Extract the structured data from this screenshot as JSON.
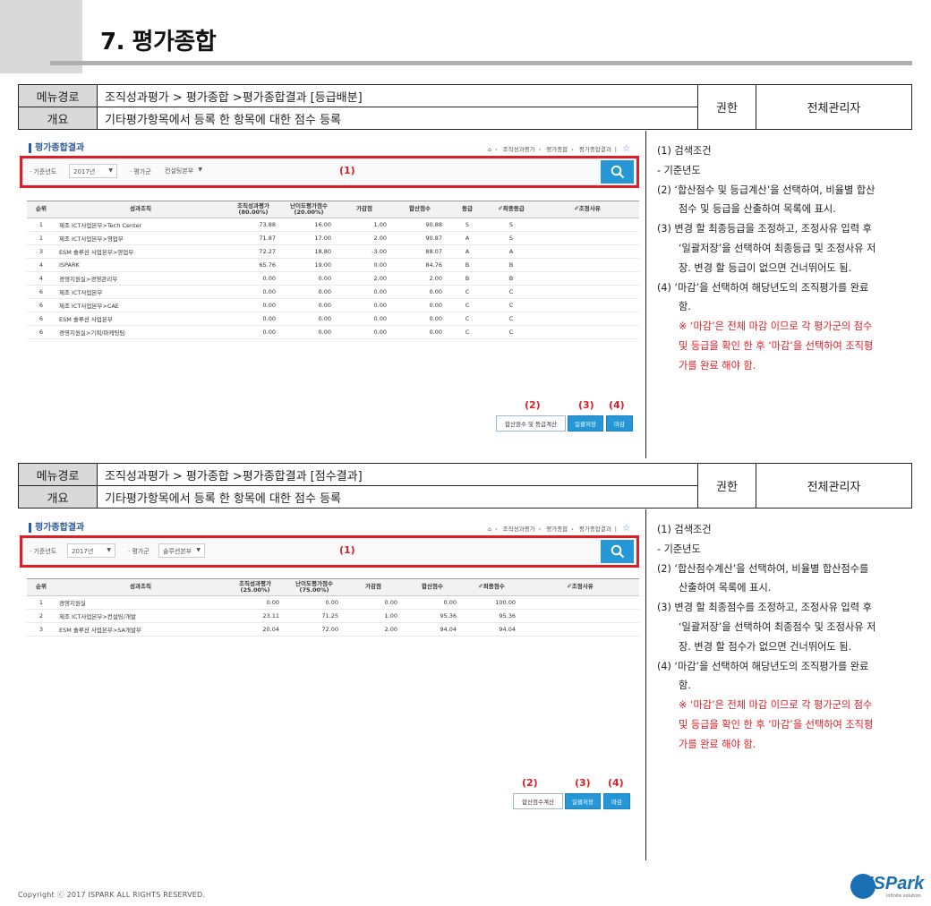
{
  "page_title": "7. 평가종합",
  "section1": {
    "menu_label": "메뉴경로",
    "menu_value": "조직성과평가 > 평가종합 >평가종합결과 [등급배분]",
    "summary_label": "개요",
    "summary_value": "기타평가항목에서 등록 한 항목에 대한 점수 등록",
    "perm_label": "권한",
    "perm_value": "전체관리자",
    "screen": {
      "title": "평가종합결과",
      "breadcrumb": [
        "조직성과평가",
        "평가종합",
        "평가종합결과"
      ],
      "year_label": "· 기준년도",
      "year_value": "2017년",
      "group_label": "· 평가군",
      "group_value": "컨설팅본부",
      "mark1": "(1)",
      "columns": [
        "순위",
        "성과조직",
        "조직성과평가 (80.00%)",
        "난이도평가점수 (20.00%)",
        "가감점",
        "합산점수",
        "등급",
        "✐최종등급",
        "✐조정사유"
      ],
      "rows": [
        [
          "1",
          "제조 ICT사업본부>Tech Center",
          "73.88",
          "16.00",
          "1.00",
          "90.88",
          "S",
          "S",
          ""
        ],
        [
          "1",
          "제조 ICT사업본부>영업부",
          "71.87",
          "17.00",
          "2.00",
          "90.87",
          "A",
          "S",
          ""
        ],
        [
          "3",
          "ESM 솔루션 사업본부>영업부",
          "72.27",
          "18.80",
          "-3.00",
          "88.07",
          "A",
          "A",
          ""
        ],
        [
          "4",
          "ISPARK",
          "65.76",
          "19.00",
          "0.00",
          "84.76",
          "B",
          "B",
          ""
        ],
        [
          "4",
          "경영지원실>경영관리부",
          "0.00",
          "0.00",
          "2.00",
          "2.00",
          "B",
          "B",
          ""
        ],
        [
          "6",
          "제조 ICT사업본부",
          "0.00",
          "0.00",
          "0.00",
          "0.00",
          "C",
          "C",
          ""
        ],
        [
          "6",
          "제조 ICT사업본부>CAE",
          "0.00",
          "0.00",
          "0.00",
          "0.00",
          "C",
          "C",
          ""
        ],
        [
          "6",
          "ESM 솔루션 사업본부",
          "0.00",
          "0.00",
          "0.00",
          "0.00",
          "C",
          "C",
          ""
        ],
        [
          "6",
          "경영지원실>기획/마케팅팀",
          "0.00",
          "0.00",
          "0.00",
          "0.00",
          "C",
          "C",
          ""
        ]
      ],
      "mark2": "(2)",
      "mark3": "(3)",
      "mark4": "(4)",
      "btn_calc": "합산점수 및 등급계산",
      "btn_save": "일괄저장",
      "btn_close": "마감"
    },
    "notes": [
      {
        "text": "(1)  검색조건",
        "style": "normal"
      },
      {
        "text": "- 기준년도",
        "style": "normal"
      },
      {
        "text": "(2)  ‘합산점수 및 등급계산’을 선택하여, 비율별 합산",
        "style": "normal"
      },
      {
        "text": "점수 및 등급을 산출하여 목록에 표시.",
        "style": "ind"
      },
      {
        "text": "(3)  변경 할 최종등급을 조정하고, 조정사유 입력 후",
        "style": "normal"
      },
      {
        "text": "‘일괄저장’을 선택하여 최종등급 및 조정사유 저",
        "style": "ind"
      },
      {
        "text": "장. 변경 할 등급이 없으면 건너뛰어도 됨.",
        "style": "ind"
      },
      {
        "text": "(4)  ‘마감’을 선택하여 해당년도의 조직평가를 완료",
        "style": "normal"
      },
      {
        "text": "함.",
        "style": "ind"
      },
      {
        "text": "※ ‘마감’은 전체 마감 이므로 각 평가군의 점수",
        "style": "red"
      },
      {
        "text": "및 등급을 확인 한 후 ‘마감’을 선택하여 조직평",
        "style": "red"
      },
      {
        "text": "가를 완료 해야 함.",
        "style": "red"
      }
    ]
  },
  "section2": {
    "menu_label": "메뉴경로",
    "menu_value": "조직성과평가 > 평가종합 >평가종합결과 [점수결과]",
    "summary_label": "개요",
    "summary_value": "기타평가항목에서 등록 한 항목에 대한 점수 등록",
    "perm_label": "권한",
    "perm_value": "전체관리자",
    "screen": {
      "title": "평가종합결과",
      "breadcrumb": [
        "조직성과평가",
        "평가종합",
        "평가종합결과"
      ],
      "year_label": "· 기준년도",
      "year_value": "2017년",
      "group_label": "· 평가군",
      "group_value": "솔루션본부",
      "mark1": "(1)",
      "columns": [
        "순위",
        "성과조직",
        "조직성과평가 (25.00%)",
        "난이도평가점수 (75.00%)",
        "가감점",
        "합산점수",
        "✐최종점수",
        "✐조정사유"
      ],
      "rows": [
        [
          "1",
          "경영지원실",
          "0.00",
          "0.00",
          "0.00",
          "0.00",
          "100.00",
          ""
        ],
        [
          "2",
          "제조 ICT사업본부>컨설팅/개발",
          "23.11",
          "71.25",
          "1.00",
          "95.36",
          "95.36",
          ""
        ],
        [
          "3",
          "ESM 솔루션 사업본부>SA개발부",
          "20.04",
          "72.00",
          "2.00",
          "94.04",
          "94.04",
          ""
        ]
      ],
      "mark2": "(2)",
      "mark3": "(3)",
      "mark4": "(4)",
      "btn_calc": "합산점수계산",
      "btn_save": "일괄저장",
      "btn_close": "마감"
    },
    "notes": [
      {
        "text": "(1)  검색조건",
        "style": "normal"
      },
      {
        "text": "- 기준년도",
        "style": "normal"
      },
      {
        "text": "(2)  ‘합산점수계산’을 선택하여, 비율별 합산점수를",
        "style": "normal"
      },
      {
        "text": "산출하여 목록에 표시.",
        "style": "ind"
      },
      {
        "text": "(3)  변경 할 최종점수를 조정하고, 조정사유 입력 후",
        "style": "normal"
      },
      {
        "text": "‘일괄저장’을 선택하여 최종점수 및 조정사유 저",
        "style": "ind"
      },
      {
        "text": "장. 변경 할 점수가 없으면 건너뛰어도 됨.",
        "style": "ind"
      },
      {
        "text": "(4)  ‘마감’을 선택하여 해당년도의 조직평가를 완료",
        "style": "normal"
      },
      {
        "text": "함.",
        "style": "ind"
      },
      {
        "text": "※ ‘마감’은 전체 마감 이므로 각 평가군의 점수",
        "style": "red"
      },
      {
        "text": "및 등급을 확인 한 후 ‘마감’을 선택하여 조직평",
        "style": "red"
      },
      {
        "text": "가를 완료 해야 함.",
        "style": "red"
      }
    ]
  },
  "footer": {
    "copyright": "Copyright ⓒ 2017 ISPARK ALL RIGHTS RESERVED.",
    "logo_text": "ISPark",
    "logo_sub": "infinite solution"
  },
  "colors": {
    "highlight_red": "#e01d25",
    "button_blue": "#2596d6",
    "title_blue": "#2e5b9c"
  }
}
